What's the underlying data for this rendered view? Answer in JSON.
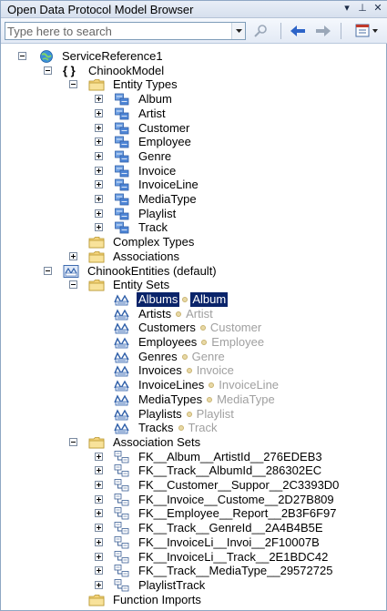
{
  "window": {
    "title": "Open Data Protocol Model Browser",
    "controls": {
      "dropdown": "▾",
      "pin": "⊥",
      "close": "✕"
    }
  },
  "toolbar": {
    "search_placeholder": "Type here to search",
    "buttons": [
      "search-go",
      "back",
      "forward",
      "options"
    ]
  },
  "tree": {
    "root": "ServiceReference1",
    "model": "ChinookModel",
    "entity_types_folder": "Entity Types",
    "entity_types": [
      "Album",
      "Artist",
      "Customer",
      "Employee",
      "Genre",
      "Invoice",
      "InvoiceLine",
      "MediaType",
      "Playlist",
      "Track"
    ],
    "complex_types_folder": "Complex Types",
    "associations_folder": "Associations",
    "container": "ChinookEntities (default)",
    "entity_sets_folder": "Entity Sets",
    "entity_sets": [
      {
        "name": "Albums",
        "type": "Album",
        "selected": true
      },
      {
        "name": "Artists",
        "type": "Artist"
      },
      {
        "name": "Customers",
        "type": "Customer"
      },
      {
        "name": "Employees",
        "type": "Employee"
      },
      {
        "name": "Genres",
        "type": "Genre"
      },
      {
        "name": "Invoices",
        "type": "Invoice"
      },
      {
        "name": "InvoiceLines",
        "type": "InvoiceLine"
      },
      {
        "name": "MediaTypes",
        "type": "MediaType"
      },
      {
        "name": "Playlists",
        "type": "Playlist"
      },
      {
        "name": "Tracks",
        "type": "Track"
      }
    ],
    "association_sets_folder": "Association Sets",
    "association_sets": [
      "FK__Album__ArtistId__276EDEB3",
      "FK__Track__AlbumId__286302EC",
      "FK__Customer__Suppor__2C3393D0",
      "FK__Invoice__Custome__2D27B809",
      "FK__Employee__Report__2B3F6F97",
      "FK__Track__GenreId__2A4B4B5E",
      "FK__InvoiceLi__Invoi__2F10007B",
      "FK__InvoiceLi__Track__2E1BDC42",
      "FK__Track__MediaType__29572725",
      "PlaylistTrack"
    ],
    "function_imports_folder": "Function Imports"
  },
  "colors": {
    "selection": "#0a246a",
    "folder": "#f3d37a",
    "entity_icon": "#3b7ad2",
    "type_ref_text": "#a0a0a0"
  }
}
